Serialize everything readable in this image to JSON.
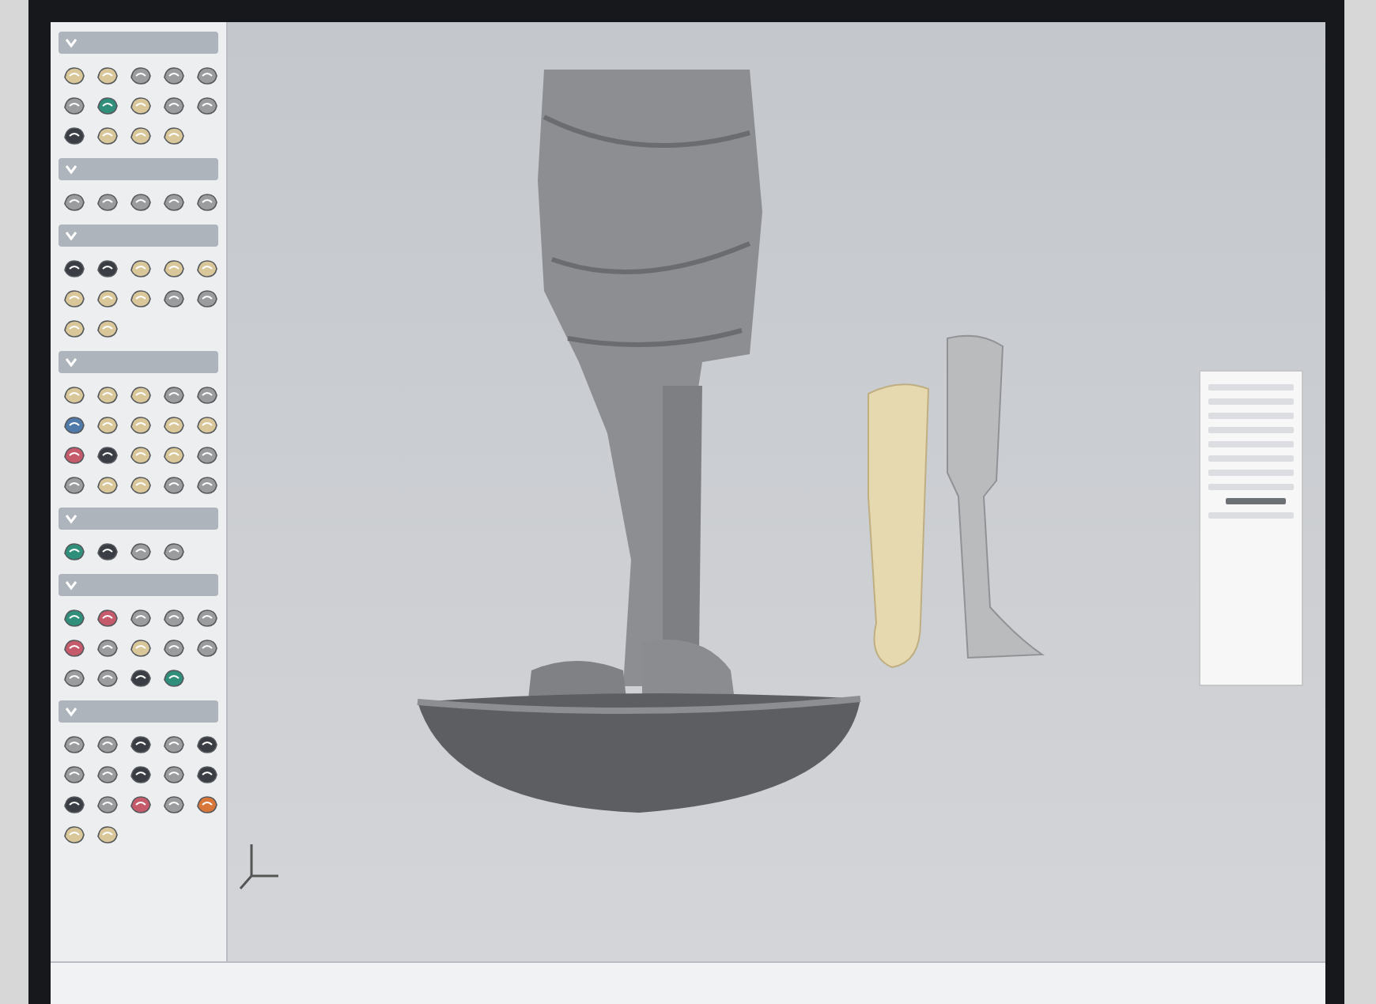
{
  "palette": {
    "sections": [
      {
        "expanded": true,
        "icons": [
          {
            "kind": "mesh"
          },
          {
            "kind": "mesh"
          },
          {
            "kind": "tool"
          },
          {
            "kind": "tool"
          },
          {
            "kind": "tool"
          },
          {
            "kind": "tool"
          },
          {
            "kind": "teal"
          },
          {
            "kind": "mesh"
          },
          {
            "kind": "tool"
          },
          {
            "kind": "tool"
          },
          {
            "kind": "dark"
          },
          {
            "kind": "mesh"
          },
          {
            "kind": "mesh"
          },
          {
            "kind": "mesh"
          }
        ]
      },
      {
        "expanded": true,
        "icons": [
          {
            "kind": "tool"
          },
          {
            "kind": "tool"
          },
          {
            "kind": "tool"
          },
          {
            "kind": "tool"
          },
          {
            "kind": "tool"
          }
        ]
      },
      {
        "expanded": true,
        "icons": [
          {
            "kind": "dark"
          },
          {
            "kind": "dark"
          },
          {
            "kind": "mesh"
          },
          {
            "kind": "mesh"
          },
          {
            "kind": "mesh"
          },
          {
            "kind": "mesh"
          },
          {
            "kind": "mesh"
          },
          {
            "kind": "mesh"
          },
          {
            "kind": "tool"
          },
          {
            "kind": "tool"
          },
          {
            "kind": "mesh"
          },
          {
            "kind": "mesh"
          }
        ]
      },
      {
        "expanded": true,
        "icons": [
          {
            "kind": "mesh"
          },
          {
            "kind": "mesh"
          },
          {
            "kind": "mesh"
          },
          {
            "kind": "tool"
          },
          {
            "kind": "tool"
          },
          {
            "kind": "blue"
          },
          {
            "kind": "mesh"
          },
          {
            "kind": "mesh"
          },
          {
            "kind": "mesh"
          },
          {
            "kind": "mesh"
          },
          {
            "kind": "paint"
          },
          {
            "kind": "dark"
          },
          {
            "kind": "mesh"
          },
          {
            "kind": "mesh"
          },
          {
            "kind": "tool"
          },
          {
            "kind": "tool"
          },
          {
            "kind": "mesh"
          },
          {
            "kind": "mesh"
          },
          {
            "kind": "tool"
          },
          {
            "kind": "tool"
          }
        ]
      },
      {
        "expanded": true,
        "icons": [
          {
            "kind": "teal"
          },
          {
            "kind": "dark"
          },
          {
            "kind": "tool"
          },
          {
            "kind": "tool"
          }
        ]
      },
      {
        "expanded": true,
        "icons": [
          {
            "kind": "teal"
          },
          {
            "kind": "paint"
          },
          {
            "kind": "tool"
          },
          {
            "kind": "tool"
          },
          {
            "kind": "tool"
          },
          {
            "kind": "paint"
          },
          {
            "kind": "tool"
          },
          {
            "kind": "mesh"
          },
          {
            "kind": "tool"
          },
          {
            "kind": "tool"
          },
          {
            "kind": "tool"
          },
          {
            "kind": "tool"
          },
          {
            "kind": "dark"
          },
          {
            "kind": "teal"
          }
        ]
      },
      {
        "expanded": true,
        "icons": [
          {
            "kind": "tool"
          },
          {
            "kind": "tool"
          },
          {
            "kind": "dark"
          },
          {
            "kind": "tool"
          },
          {
            "kind": "dark"
          },
          {
            "kind": "tool"
          },
          {
            "kind": "tool"
          },
          {
            "kind": "dark"
          },
          {
            "kind": "tool"
          },
          {
            "kind": "dark"
          },
          {
            "kind": "dark"
          },
          {
            "kind": "tool"
          },
          {
            "kind": "paint"
          },
          {
            "kind": "tool"
          },
          {
            "kind": "orange"
          },
          {
            "kind": "mesh"
          },
          {
            "kind": "mesh"
          }
        ]
      }
    ]
  },
  "properties_panel": {
    "rows": [
      {
        "selected": false
      },
      {
        "selected": false
      },
      {
        "selected": false
      },
      {
        "selected": false
      },
      {
        "selected": false
      },
      {
        "selected": false
      },
      {
        "selected": false
      },
      {
        "selected": false
      },
      {
        "selected": true
      },
      {
        "selected": false
      }
    ]
  }
}
